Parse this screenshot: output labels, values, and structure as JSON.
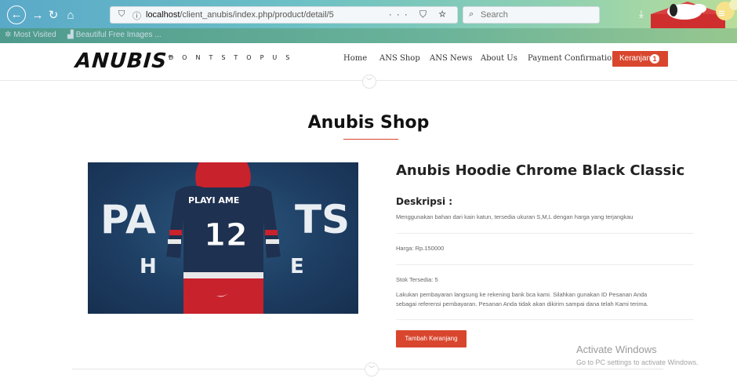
{
  "browser": {
    "url_host": "localhost",
    "url_path": "/client_anubis/index.php/product/detail/5",
    "search_placeholder": "Search",
    "url_actions": "··· ⛉ ☆",
    "bookmarks": [
      {
        "label": "Most Visited",
        "icon": "gear-icon"
      },
      {
        "label": "Beautiful Free Images ...",
        "icon": "image-icon"
      }
    ]
  },
  "header": {
    "logo": "ANUBIS",
    "logo_tm": "™",
    "tagline": "DONTSTOPUS",
    "nav": [
      "Home",
      "ANS Shop",
      "ANS News",
      "About Us",
      "Payment Confirmation"
    ],
    "cart_label": "Keranjang",
    "cart_count": "1"
  },
  "page": {
    "title": "Anubis Shop"
  },
  "product": {
    "name": "Anubis Hoodie Chrome Black Classic",
    "image_text": {
      "left": "PA",
      "right": "TS",
      "back_name": "PLAYI    AME",
      "number": "12",
      "h": "H",
      "e": "E"
    },
    "desc_heading": "Deskripsi :",
    "description": "Menggunakan bahan dari kain katun, tersedia ukuran S,M,L dengan harga yang terjangkau",
    "price": "Harga: Rp.150000",
    "stock": "Stok Tersedia: 5",
    "payment_note_1": "Lakukan pembayaran langsung ke rekening bank bca kami. Silahkan gunakan ID Pesanan Anda",
    "payment_note_2": "sebagai referensi pembayaran. Pesanan Anda tidak akan dikirim sampai dana telah Kami terima.",
    "add_to_cart": "Tambah Keranjang"
  },
  "windows_watermark": {
    "title": "Activate Windows",
    "subtitle": "Go to PC settings to activate Windows."
  },
  "colors": {
    "accent": "#d9462e",
    "hoodie_navy": "#1f3150",
    "hoodie_red": "#c8222d"
  }
}
